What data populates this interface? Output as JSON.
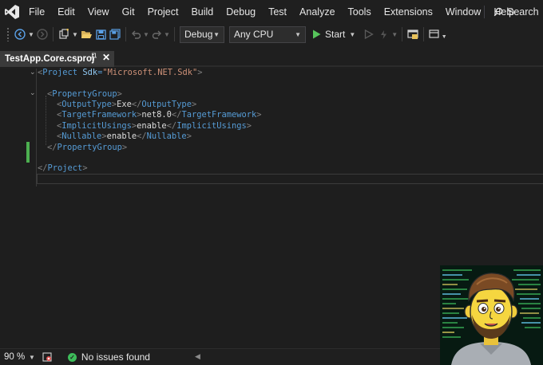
{
  "menubar": {
    "items": [
      "File",
      "Edit",
      "View",
      "Git",
      "Project",
      "Build",
      "Debug",
      "Test",
      "Analyze",
      "Tools",
      "Extensions",
      "Window",
      "Help"
    ],
    "search_label": "Search"
  },
  "toolbar": {
    "config": "Debug",
    "platform": "Any CPU",
    "start_label": "Start"
  },
  "tab": {
    "title": "TestApp.Core.csproj",
    "pin_icon": "pin-icon",
    "close_icon": "close-icon"
  },
  "code": {
    "lines": [
      {
        "open": "<",
        "tag": "Project",
        "attr": "Sdk",
        "eq": "=",
        "str": "\"Microsoft.NET.Sdk\"",
        "close": ">"
      },
      {
        "text": ""
      },
      {
        "open": "<",
        "tag": "PropertyGroup",
        "close": ">"
      },
      {
        "open": "<",
        "tag": "OutputType",
        "inner": "Exe",
        "endtag": "OutputType"
      },
      {
        "open": "<",
        "tag": "TargetFramework",
        "inner": "net8.0",
        "endtag": "TargetFramework"
      },
      {
        "open": "<",
        "tag": "ImplicitUsings",
        "inner": "enable",
        "endtag": "ImplicitUsings"
      },
      {
        "open": "<",
        "tag": "Nullable",
        "inner": "enable",
        "endtag": "Nullable"
      },
      {
        "open": "</",
        "tag": "PropertyGroup",
        "close": ">"
      },
      {
        "text": ""
      },
      {
        "open": "</",
        "tag": "Project",
        "close": ">"
      }
    ]
  },
  "status": {
    "zoom": "90 %",
    "issues": "No issues found"
  },
  "colors": {
    "tag": "#569cd6",
    "attribute": "#92caf4",
    "string": "#ce9178",
    "change_bar": "#4caf50",
    "start_green": "#57c45b"
  }
}
